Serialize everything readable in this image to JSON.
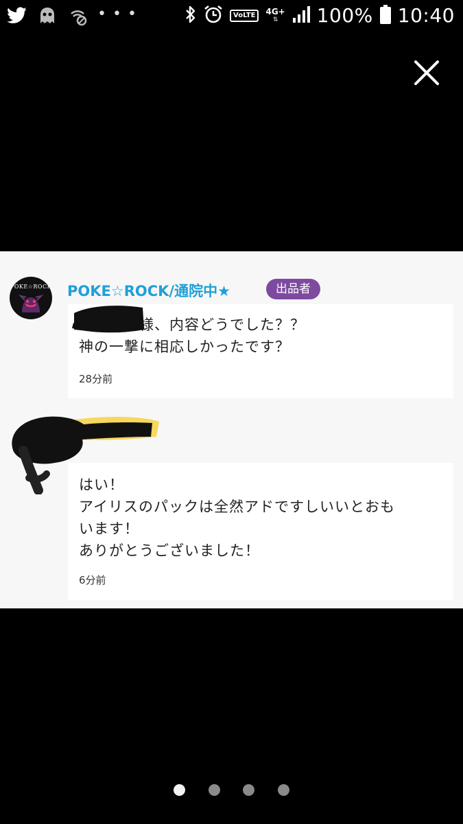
{
  "status_bar": {
    "icons_left": [
      "twitter-icon",
      "ghost-app-icon",
      "no-signal-app-icon",
      "more-dots-icon"
    ],
    "overflow_dots": "• • •",
    "icons_right": [
      "bluetooth-icon",
      "alarm-icon",
      "volte-icon",
      "network-4g-icon",
      "signal-icon",
      "battery-icon"
    ],
    "volte_label": "VoLTE",
    "network_label": "4G+",
    "battery": "100%",
    "time": "10:40"
  },
  "close_icon": "close-icon",
  "seller": {
    "name": "POKE☆ROCK/通院中★",
    "badge": "出品者",
    "avatar_text": "POKE☆ROCK",
    "name_color": "#1fa0d8",
    "badge_color": "#7d4aa0"
  },
  "comments": [
    {
      "text": "さ　　　様、内容どうでした？？\n神の一撃に相応しかったです？",
      "time": "28分前"
    },
    {
      "text": "はい！\nアイリスのパックは全然アドですしいいとおも\nいます！\nありがとうございました！",
      "time": "6分前"
    }
  ],
  "pager": {
    "count": 4,
    "active_index": 0
  }
}
